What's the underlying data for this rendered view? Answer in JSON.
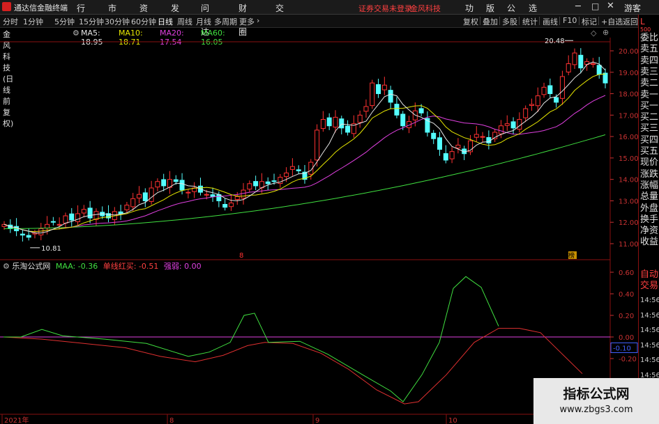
{
  "title_bar": {
    "app_name": "通达信金融终端",
    "menu": [
      "行情",
      "市场",
      "资讯",
      "发现",
      "问小达",
      "财富圈",
      "交易"
    ],
    "warning": "证券交易未登录",
    "stock": "金风科技",
    "right_menu": [
      "功能",
      "版面",
      "公式",
      "选项"
    ],
    "guest": "游客"
  },
  "toolbar": {
    "periods": [
      "分时",
      "1分钟",
      "5分钟",
      "15分钟",
      "30分钟",
      "60分钟",
      "日线",
      "周线",
      "月线",
      "多周期",
      "更多"
    ],
    "active_period": "日线",
    "right_tools": [
      "复权",
      "叠加",
      "多股",
      "统计",
      "画线",
      "F10",
      "标记",
      "+自选",
      "返回"
    ]
  },
  "main_chart": {
    "name": "金风科技(日线 前复权)",
    "ma": [
      {
        "label": "MA5: 18.95",
        "color": "#e6e6e6"
      },
      {
        "label": "MA10: 18.71",
        "color": "#e6e600"
      },
      {
        "label": "MA20: 17.54",
        "color": "#e040e0"
      },
      {
        "label": "MA60: 16.05",
        "color": "#40e040"
      }
    ],
    "high_label": "20.48",
    "low_label": "10.81",
    "marker_1": "8",
    "marker_2": "榜"
  },
  "price_axis": [
    "20.00",
    "19.00",
    "18.00",
    "17.00",
    "16.00",
    "15.00",
    "14.00",
    "13.00",
    "12.00",
    "11.00"
  ],
  "side_panel": {
    "corner": "L",
    "corner_sub": "500",
    "items": [
      "委比",
      "卖五",
      "卖四",
      "卖三",
      "卖二",
      "卖一",
      "买一",
      "买二",
      "买三",
      "买四",
      "买五",
      "现价",
      "涨跌",
      "涨幅",
      "总量",
      "外盘",
      "换手",
      "净资",
      "收益"
    ],
    "lower": [
      "自动",
      "交易"
    ],
    "times": [
      "14:56",
      "14:56",
      "14:56",
      "14:56",
      "14:56",
      "14:56",
      "14:56"
    ]
  },
  "indicator": {
    "name": "乐淘公式网",
    "values": [
      {
        "label": "MAA: -0.36",
        "color": "#40e040"
      },
      {
        "label": "单线红买: -0.51",
        "color": "#ff4040"
      },
      {
        "label": "强弱: 0.00",
        "color": "#e040e0"
      }
    ],
    "axis": [
      "0.60",
      "0.40",
      "0.20",
      "0.00",
      "-0.20",
      "-0.40"
    ],
    "current_value": "-0.10"
  },
  "date_axis": [
    "2021年",
    "8",
    "9",
    "10"
  ],
  "watermark": {
    "title": "指标公式网",
    "url": "www.zbgs3.com"
  },
  "colors": {
    "up": "#ff3232",
    "down": "#54ffff",
    "ma5": "#e6e6e6",
    "ma10": "#e6e600",
    "ma20": "#e040e0",
    "ma60": "#40e040",
    "axis": "#c83232"
  }
}
